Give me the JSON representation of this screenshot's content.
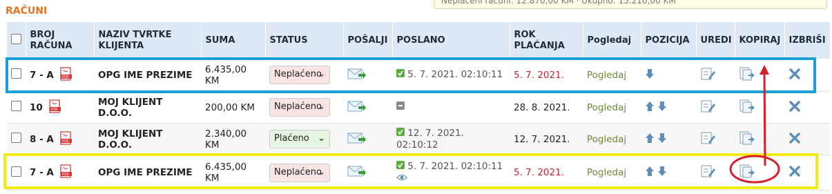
{
  "page": {
    "title": "RAČUNI",
    "note": "Neplaćeni računi: 12.870,00 KM · Ukupno: 15.210,00 KM"
  },
  "columns": [
    "",
    "BROJ RAČUNA",
    "NAZIV TVRTKE KLIJENTA",
    "SUMA",
    "STATUS",
    "POŠALJI",
    "POSLANO",
    "ROK PLAĆANJA",
    "Pogledaj",
    "POZICIJA",
    "UREDI",
    "KOPIRAJ",
    "IZBRIŠI"
  ],
  "rows": [
    {
      "number": "7 - A",
      "client": "OPG IME PREZIME",
      "sum": "6.435,00 KM",
      "status": "Neplaćeno",
      "sent": "5. 7. 2021. 02:10:11",
      "due": "5. 7. 2021.",
      "view": "Pogledaj"
    },
    {
      "number": "10",
      "client": "MOJ KLIJENT D.O.O.",
      "sum": "200,00 KM",
      "status": "Neplaćeno",
      "sent": "",
      "due": "28. 8. 2021.",
      "view": "Pogledaj"
    },
    {
      "number": "8 - A",
      "client": "MOJ KLIJENT D.O.O.",
      "sum": "2.340,00 KM",
      "status": "Plaćeno",
      "sent": "12. 7. 2021. 02:10:12",
      "due": "12. 7. 2021.",
      "view": "Pogledaj"
    },
    {
      "number": "7 - A",
      "client": "OPG IME PREZIME",
      "sum": "6.435,00 KM",
      "status": "Neplaćeno",
      "sent": "5. 7. 2021. 02:10:11",
      "due": "5. 7. 2021.",
      "view": "Pogledaj"
    }
  ],
  "colors": {
    "accent": "#e8731c",
    "header_bg": "#dfe9f5",
    "highlight_blue": "#1aa0d8",
    "highlight_yellow": "#f3e914",
    "annotation_red": "#d4202b"
  },
  "icons": [
    "pdf-icon",
    "send-envelope-icon",
    "checkmark-icon",
    "pending-icon",
    "eye-icon",
    "arrow-up-icon",
    "arrow-down-icon",
    "edit-icon",
    "copy-icon",
    "delete-x-icon"
  ]
}
